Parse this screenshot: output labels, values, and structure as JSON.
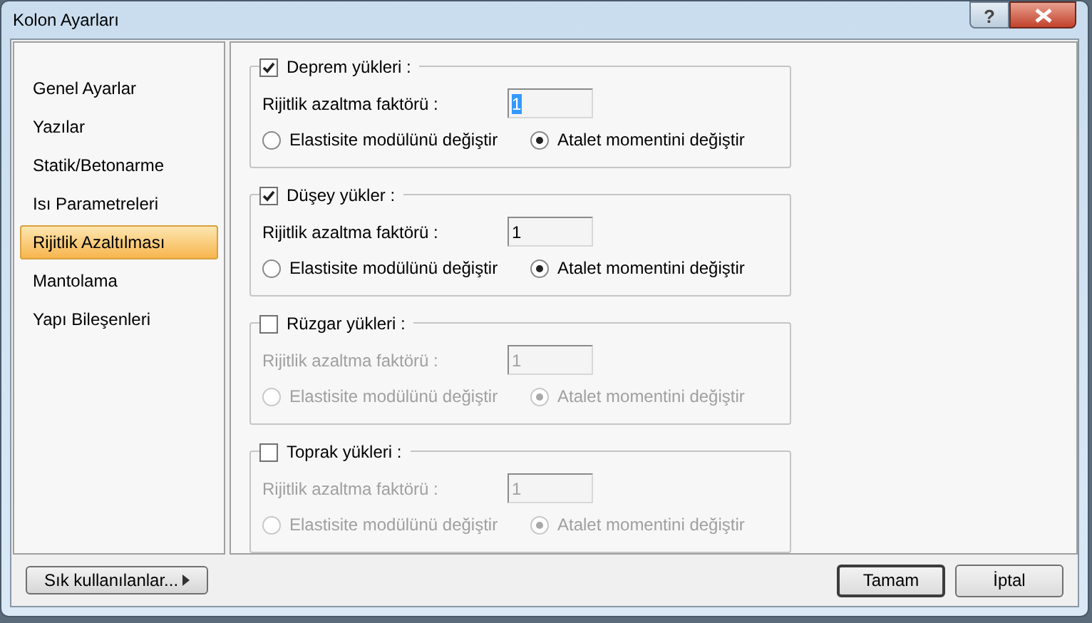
{
  "window": {
    "title": "Kolon Ayarları",
    "help_button": "?"
  },
  "sidebar": {
    "items": [
      {
        "label": "Genel Ayarlar",
        "selected": false
      },
      {
        "label": "Yazılar",
        "selected": false
      },
      {
        "label": "Statik/Betonarme",
        "selected": false
      },
      {
        "label": "Isı Parametreleri",
        "selected": false
      },
      {
        "label": "Rijitlik Azaltılması",
        "selected": true
      },
      {
        "label": "Mantolama",
        "selected": false
      },
      {
        "label": "Yapı Bileşenleri",
        "selected": false
      }
    ]
  },
  "groups": [
    {
      "label": "Deprem yükleri :",
      "checked": true,
      "disabled": false,
      "factor_label": "Rijitlik azaltma faktörü :",
      "factor_value": "1",
      "value_highlighted": true,
      "options": [
        {
          "label": "Elastisite modülünü değiştir",
          "selected": false
        },
        {
          "label": "Atalet momentini değiştir",
          "selected": true
        }
      ]
    },
    {
      "label": "Düşey yükler :",
      "checked": true,
      "disabled": false,
      "factor_label": "Rijitlik azaltma faktörü :",
      "factor_value": "1",
      "value_highlighted": false,
      "options": [
        {
          "label": "Elastisite modülünü değiştir",
          "selected": false
        },
        {
          "label": "Atalet momentini değiştir",
          "selected": true
        }
      ]
    },
    {
      "label": "Rüzgar yükleri :",
      "checked": false,
      "disabled": true,
      "factor_label": "Rijitlik azaltma faktörü :",
      "factor_value": "1",
      "value_highlighted": false,
      "options": [
        {
          "label": "Elastisite modülünü değiştir",
          "selected": false
        },
        {
          "label": "Atalet momentini değiştir",
          "selected": true
        }
      ]
    },
    {
      "label": "Toprak yükleri :",
      "checked": false,
      "disabled": true,
      "factor_label": "Rijitlik azaltma faktörü :",
      "factor_value": "1",
      "value_highlighted": false,
      "options": [
        {
          "label": "Elastisite modülünü değiştir",
          "selected": false
        },
        {
          "label": "Atalet momentini değiştir",
          "selected": true
        }
      ]
    }
  ],
  "footer": {
    "favorites_button": "Sık kullanılanlar...",
    "ok_button": "Tamam",
    "cancel_button": "İptal"
  }
}
